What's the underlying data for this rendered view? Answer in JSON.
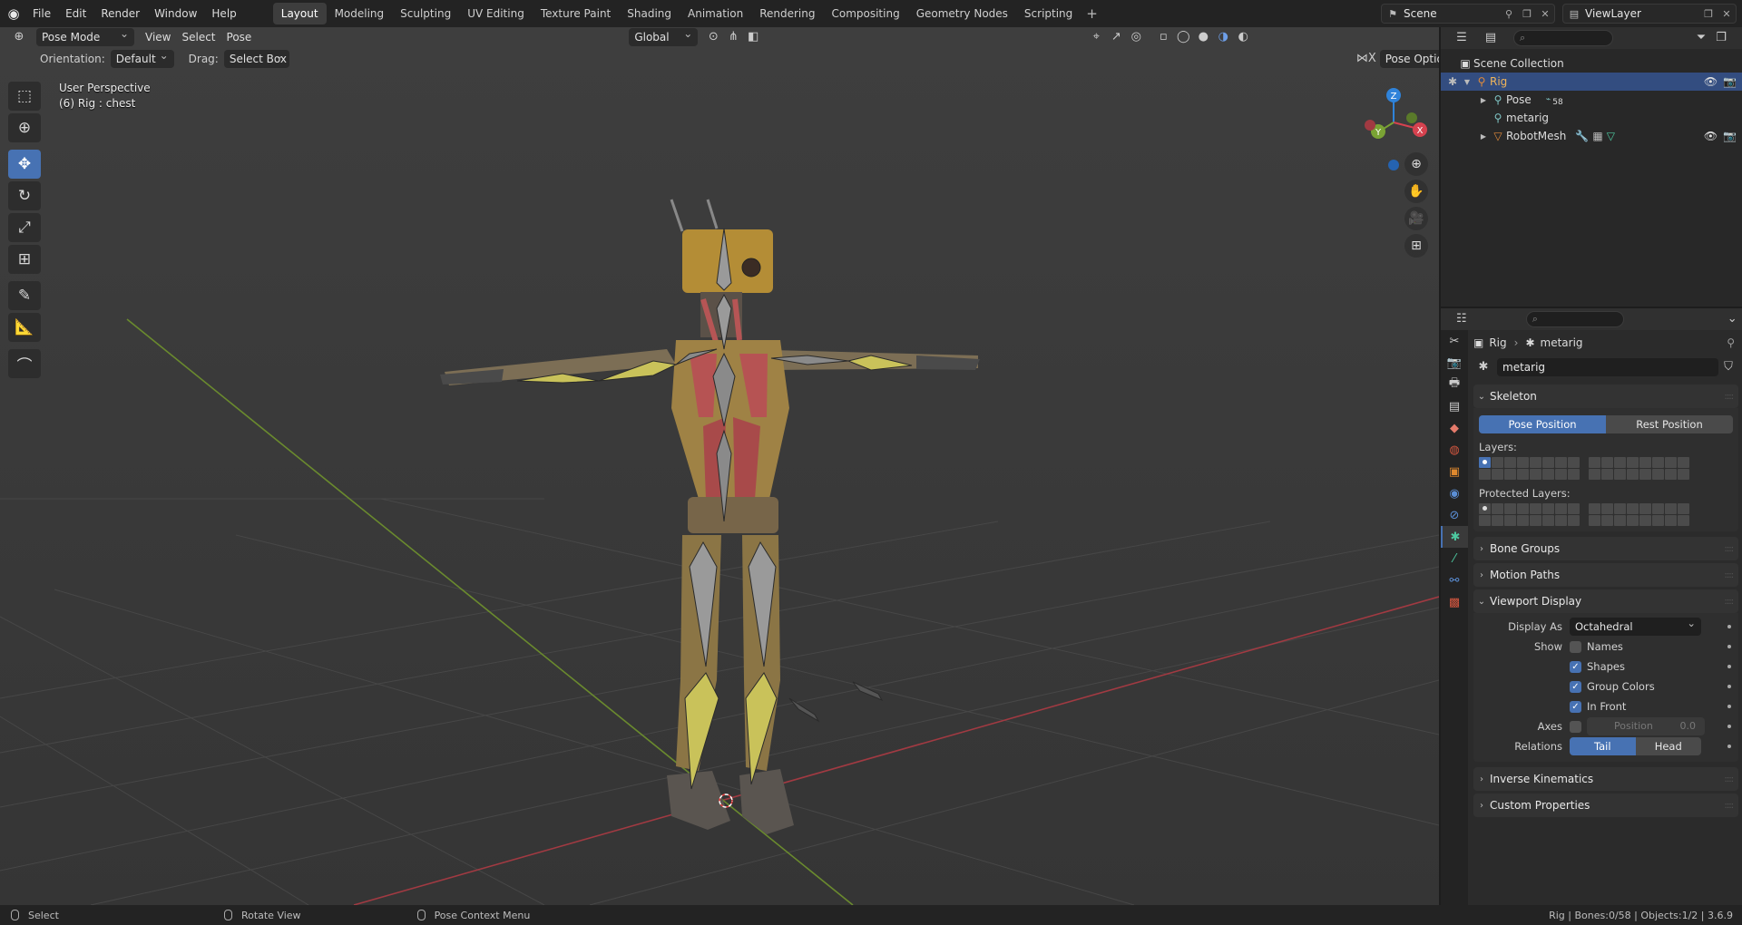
{
  "topbar": {
    "menus": [
      "File",
      "Edit",
      "Render",
      "Window",
      "Help"
    ],
    "workspaces": [
      "Layout",
      "Modeling",
      "Sculpting",
      "UV Editing",
      "Texture Paint",
      "Shading",
      "Animation",
      "Rendering",
      "Compositing",
      "Geometry Nodes",
      "Scripting"
    ],
    "active_workspace": "Layout",
    "scene": "Scene",
    "view_layer": "ViewLayer"
  },
  "viewport": {
    "mode": "Pose Mode",
    "menus": [
      "View",
      "Select",
      "Pose"
    ],
    "transform_orientation": "Global",
    "orientation_label": "Orientation:",
    "orientation_value": "Default",
    "drag_label": "Drag:",
    "drag_value": "Select Box",
    "pose_options": "Pose Options",
    "info_line1": "User Perspective",
    "info_line2": "(6) Rig : chest",
    "gizmo_axes": {
      "x": "X",
      "y": "Y",
      "z": "Z"
    }
  },
  "outliner": {
    "root": "Scene Collection",
    "items": [
      {
        "name": "Rig",
        "selected": true
      },
      {
        "name": "Pose",
        "badge": "58"
      },
      {
        "name": "metarig"
      },
      {
        "name": "RobotMesh"
      }
    ]
  },
  "properties": {
    "breadcrumb_object": "Rig",
    "breadcrumb_data": "metarig",
    "datablock": "metarig",
    "skeleton": {
      "title": "Skeleton",
      "pose_position": "Pose Position",
      "rest_position": "Rest Position",
      "layers_label": "Layers:",
      "protected_label": "Protected Layers:"
    },
    "collapsed_panels": [
      "Bone Groups",
      "Motion Paths"
    ],
    "viewport_display": {
      "title": "Viewport Display",
      "display_as_label": "Display As",
      "display_as_value": "Octahedral",
      "show_label": "Show",
      "names": "Names",
      "shapes": "Shapes",
      "group_colors": "Group Colors",
      "in_front": "In Front",
      "axes_label": "Axes",
      "position_label": "Position",
      "position_value": "0.0",
      "relations_label": "Relations",
      "tail": "Tail",
      "head": "Head"
    },
    "bottom_panels": [
      "Inverse Kinematics",
      "Custom Properties"
    ]
  },
  "statusbar": {
    "select": "Select",
    "rotate": "Rotate View",
    "context": "Pose Context Menu",
    "stats": "Rig | Bones:0/58 | Objects:1/2 | 3.6.9"
  },
  "colors": {
    "accent": "#4772b3",
    "x_axis": "#d6424f",
    "y_axis": "#7aa334",
    "z_axis": "#2f83da",
    "bone_yellow": "#c9c25a"
  }
}
